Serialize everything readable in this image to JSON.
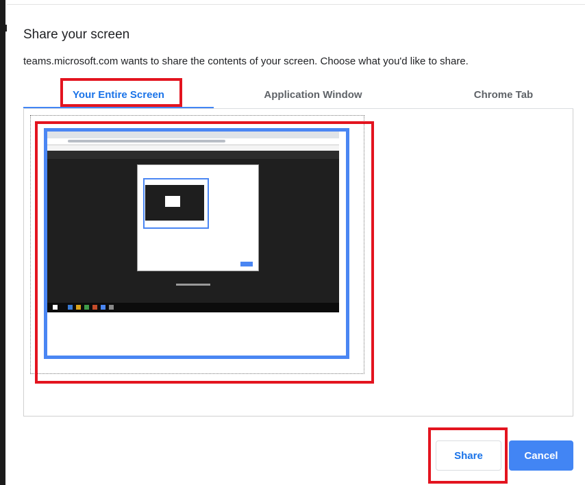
{
  "dialog": {
    "title": "Share your screen",
    "description": "teams.microsoft.com wants to share the contents of your screen. Choose what you'd like to share."
  },
  "tabs": [
    {
      "label": "Your Entire Screen",
      "active": true
    },
    {
      "label": "Application Window",
      "active": false
    },
    {
      "label": "Chrome Tab",
      "active": false
    }
  ],
  "buttons": {
    "share_label": "Share",
    "cancel_label": "Cancel"
  },
  "colors": {
    "accent": "#4285f4",
    "annotation": "#e3141f"
  }
}
